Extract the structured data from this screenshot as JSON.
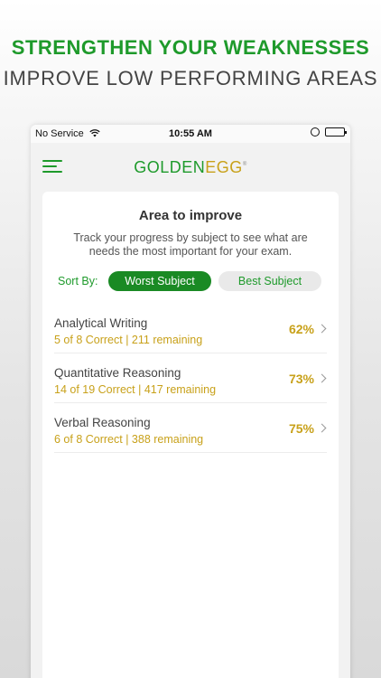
{
  "promo": {
    "headline": "STRENGTHEN YOUR WEAKNESSES",
    "subheadline": "IMPROVE LOW PERFORMING AREAS"
  },
  "status_bar": {
    "carrier": "No Service",
    "time": "10:55 AM"
  },
  "nav": {
    "logo_part1": "GOLDEN",
    "logo_part2": "EGG",
    "logo_mark": "®"
  },
  "card": {
    "title": "Area to improve",
    "description": "Track your progress by subject to see what are needs the most important for your exam.",
    "sort_label": "Sort By:",
    "sort_options": [
      "Worst Subject",
      "Best Subject"
    ],
    "selected_sort": "Worst Subject"
  },
  "subjects": [
    {
      "name": "Analytical Writing",
      "stats": "5 of 8  Correct | 211 remaining",
      "percent": "62%"
    },
    {
      "name": "Quantitative Reasoning",
      "stats": "14 of 19  Correct | 417 remaining",
      "percent": "73%"
    },
    {
      "name": "Verbal Reasoning",
      "stats": "6 of 8  Correct | 388 remaining",
      "percent": "75%"
    }
  ],
  "colors": {
    "brand_green": "#1e9a2b",
    "gold": "#c8a11a"
  }
}
